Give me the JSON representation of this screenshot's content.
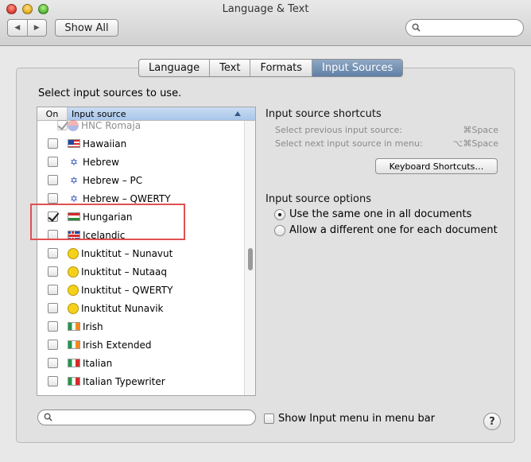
{
  "window": {
    "title": "Language & Text",
    "show_all_label": "Show All",
    "nav_back": "◀",
    "nav_forward": "▶"
  },
  "tabs": [
    {
      "label": "Language",
      "active": false
    },
    {
      "label": "Text",
      "active": false
    },
    {
      "label": "Formats",
      "active": false
    },
    {
      "label": "Input Sources",
      "active": true
    }
  ],
  "input_sources": {
    "prompt": "Select input sources to use.",
    "col_on": "On",
    "col_source": "Input source",
    "rows": [
      {
        "label": "HNC Romaja",
        "icon": "hnc-icon",
        "checked": true,
        "disabled": true
      },
      {
        "label": "Hawaiian",
        "icon": "hawaiian-flag-icon",
        "checked": false
      },
      {
        "label": "Hebrew",
        "icon": "star-of-david-icon",
        "checked": false
      },
      {
        "label": "Hebrew – PC",
        "icon": "star-of-david-icon",
        "checked": false
      },
      {
        "label": "Hebrew – QWERTY",
        "icon": "star-of-david-icon",
        "checked": false
      },
      {
        "label": "Hungarian",
        "icon": "hungarian-flag-icon",
        "checked": true
      },
      {
        "label": "Icelandic",
        "icon": "icelandic-flag-icon",
        "checked": false
      },
      {
        "label": "Inuktitut – Nunavut",
        "icon": "inuktitut-icon",
        "checked": false
      },
      {
        "label": "Inuktitut – Nutaaq",
        "icon": "inuktitut-icon",
        "checked": false
      },
      {
        "label": "Inuktitut – QWERTY",
        "icon": "inuktitut-icon",
        "checked": false
      },
      {
        "label": "Inuktitut Nunavik",
        "icon": "inuktitut-icon",
        "checked": false
      },
      {
        "label": "Irish",
        "icon": "irish-flag-icon",
        "checked": false
      },
      {
        "label": "Irish Extended",
        "icon": "irish-flag-icon",
        "checked": false
      },
      {
        "label": "Italian",
        "icon": "italian-flag-icon",
        "checked": false
      },
      {
        "label": "Italian Typewriter",
        "icon": "italian-flag-icon",
        "checked": false
      }
    ]
  },
  "shortcuts": {
    "title": "Input source shortcuts",
    "previous_label": "Select previous input source:",
    "previous_key": "⌘Space",
    "next_label": "Select next input source in menu:",
    "next_key": "⌥⌘Space",
    "keyboard_button": "Keyboard Shortcuts…"
  },
  "options": {
    "title": "Input source options",
    "same_label": "Use the same one in all documents",
    "different_label": "Allow a different one for each document",
    "selected": "same"
  },
  "bottom": {
    "search_placeholder": "",
    "show_menu_label": "Show Input menu in menu bar",
    "show_menu_checked": false,
    "help_label": "?"
  },
  "colors": {
    "active_tab": "#6f8db3",
    "highlight": "#e05050"
  }
}
